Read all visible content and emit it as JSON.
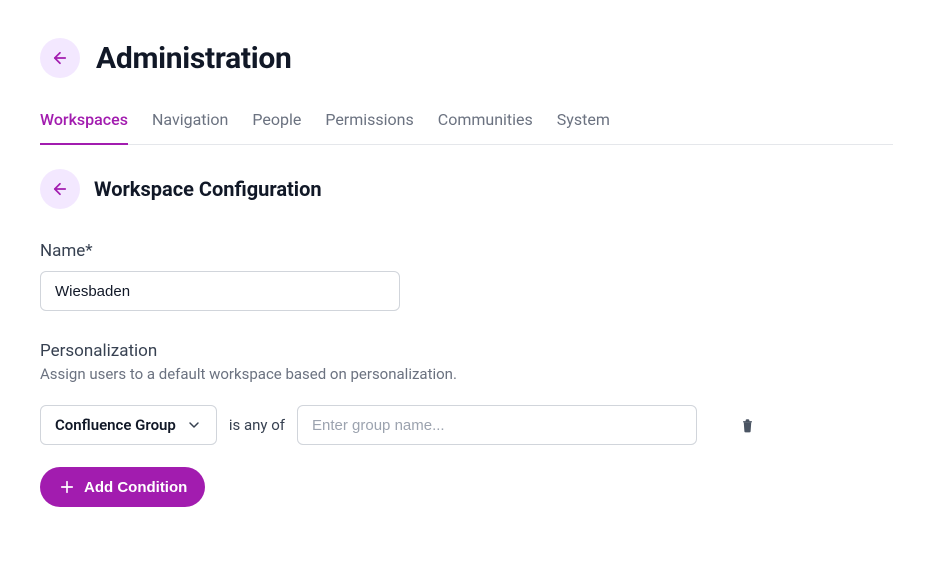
{
  "header": {
    "title": "Administration"
  },
  "tabs": [
    {
      "label": "Workspaces",
      "active": true
    },
    {
      "label": "Navigation",
      "active": false
    },
    {
      "label": "People",
      "active": false
    },
    {
      "label": "Permissions",
      "active": false
    },
    {
      "label": "Communities",
      "active": false
    },
    {
      "label": "System",
      "active": false
    }
  ],
  "section": {
    "title": "Workspace Configuration"
  },
  "name_field": {
    "label": "Name*",
    "value": "Wiesbaden"
  },
  "personalization": {
    "title": "Personalization",
    "description": "Assign users to a default workspace based on personalization.",
    "condition": {
      "type_label": "Confluence Group",
      "operator": "is any of",
      "value": "",
      "placeholder": "Enter group name..."
    },
    "add_button_label": "Add Condition"
  }
}
